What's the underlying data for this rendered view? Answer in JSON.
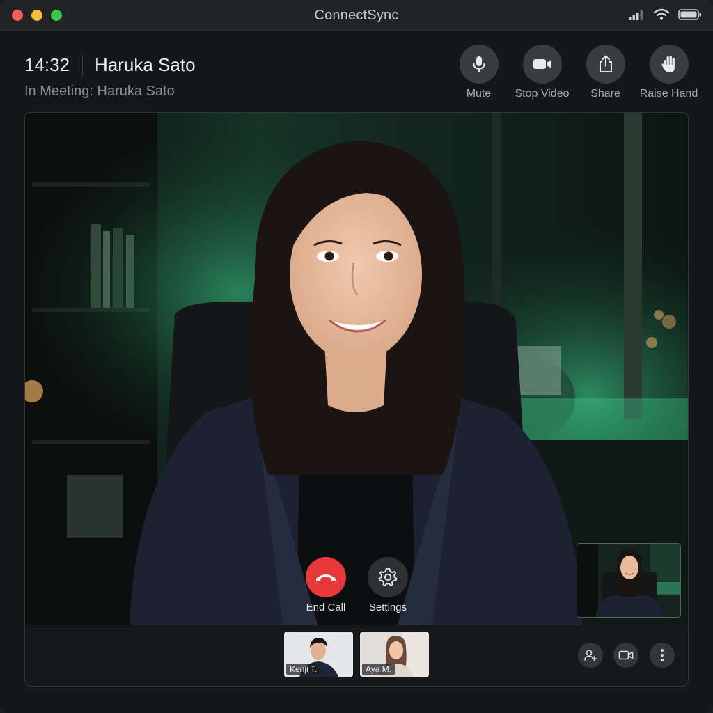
{
  "app": {
    "title": "ConnectSync"
  },
  "header": {
    "time": "14:32",
    "caller_name": "Haruka Sato",
    "meeting_status": "In Meeting: Haruka Sato"
  },
  "top_controls": [
    {
      "label": "Mute",
      "icon": "microphone-icon"
    },
    {
      "label": "Stop Video",
      "icon": "video-camera-icon"
    },
    {
      "label": "Share",
      "icon": "share-icon"
    },
    {
      "label": "Raise Hand",
      "icon": "hand-icon"
    }
  ],
  "call_controls": {
    "end_call_label": "End Call",
    "settings_label": "Settings"
  },
  "participants": [
    {
      "name": "Kenji T."
    },
    {
      "name": "Aya M."
    }
  ],
  "strip_actions": [
    "add-participant-icon",
    "video-camera-icon",
    "more-options-icon"
  ],
  "colors": {
    "end_call": "#e5393b",
    "accent_glow": "#3fd38f",
    "window_bg": "#15171b"
  }
}
